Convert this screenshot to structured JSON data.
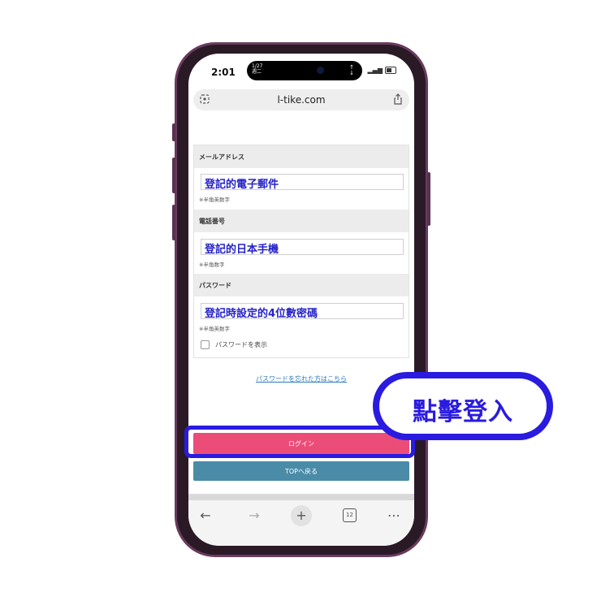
{
  "status_bar": {
    "time": "2:01",
    "date_line1": "1/27",
    "date_line2": "週二"
  },
  "browser": {
    "url": "l-tike.com",
    "tab_count": "12"
  },
  "form": {
    "email": {
      "label": "メールアドレス",
      "value": "登記的電子郵件",
      "note": "※半角英数字"
    },
    "phone": {
      "label": "電話番号",
      "value": "登記的日本手機",
      "note": "※半角数字"
    },
    "password": {
      "label": "パスワード",
      "value": "登記時設定的4位數密碼",
      "note": "※半角英数字"
    },
    "show_password_label": "パスワードを表示"
  },
  "forgot_password_link": "パスワードを忘れた方はこちら",
  "buttons": {
    "login": "ログイン",
    "top": "TOPへ戻る"
  },
  "callout": "點擊登入",
  "colors": {
    "login": "#ec4d78",
    "top": "#4a8ca8",
    "annotation": "#2a1be0",
    "field_text": "#2522c8"
  }
}
